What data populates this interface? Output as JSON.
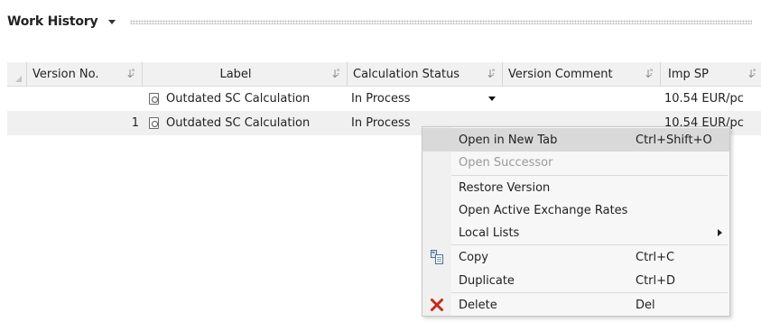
{
  "header": {
    "title": "Work History"
  },
  "grid": {
    "columns": [
      {
        "label": "Version No."
      },
      {
        "label": "Label"
      },
      {
        "label": "Calculation Status"
      },
      {
        "label": "Version Comment"
      },
      {
        "label": "Imp SP"
      }
    ],
    "rows": [
      {
        "version": "",
        "label": "Outdated SC Calculation",
        "status": "In Process",
        "comment": "",
        "imp_sp": "10.54 EUR/pc"
      },
      {
        "version": "1",
        "label": "Outdated SC Calculation",
        "status": "In Process",
        "comment": "",
        "imp_sp": "10.54 EUR/pc"
      }
    ]
  },
  "context_menu": {
    "items": [
      {
        "label": "Open in New Tab",
        "shortcut": "Ctrl+Shift+O"
      },
      {
        "label": "Open Successor",
        "shortcut": ""
      },
      {
        "label": "Restore Version",
        "shortcut": ""
      },
      {
        "label": "Open Active Exchange Rates",
        "shortcut": ""
      },
      {
        "label": "Local Lists",
        "shortcut": ""
      },
      {
        "label": "Copy",
        "shortcut": "Ctrl+C"
      },
      {
        "label": "Duplicate",
        "shortcut": "Ctrl+D"
      },
      {
        "label": "Delete",
        "shortcut": "Del"
      }
    ]
  },
  "icons": {
    "header_dropdown": "chevron-down-icon",
    "sort": "sort-icon",
    "row_document": "document-icon",
    "copy": "copy-icon",
    "delete": "delete-x-icon",
    "submenu": "chevron-right-icon"
  },
  "colors": {
    "menu_highlight": "#d9d9d9",
    "delete_icon": "#c42b1c",
    "alt_row": "#f0f0f0"
  }
}
